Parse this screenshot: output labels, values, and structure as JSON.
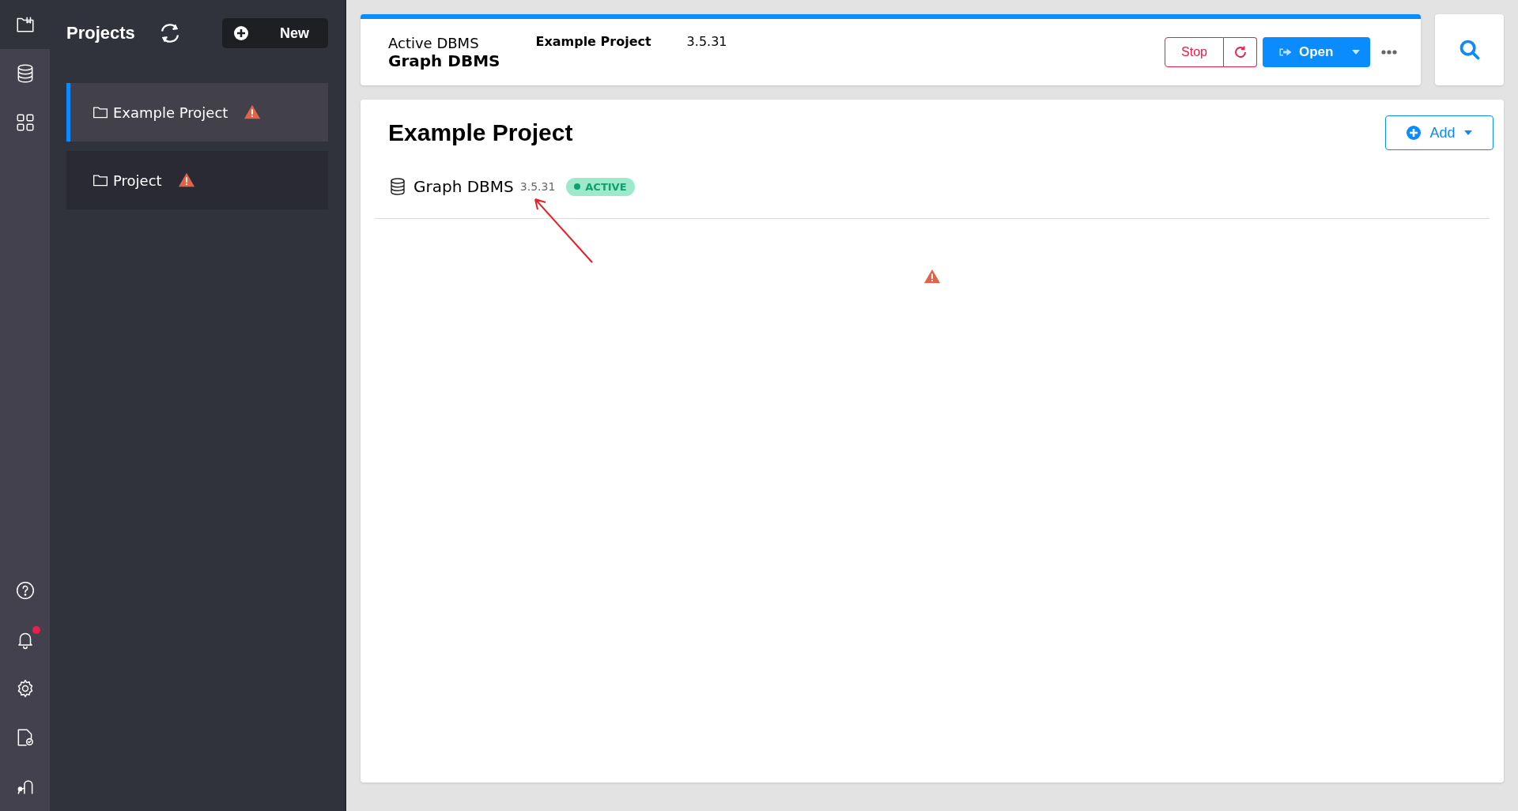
{
  "rail": {
    "top": [
      {
        "kind": "projects",
        "selected": true
      },
      {
        "kind": "database",
        "selected": false
      },
      {
        "kind": "apps",
        "selected": false
      }
    ],
    "bottom": [
      {
        "kind": "help",
        "badge": false
      },
      {
        "kind": "bell",
        "badge": true
      },
      {
        "kind": "settings",
        "badge": false
      },
      {
        "kind": "license",
        "badge": false
      },
      {
        "kind": "graph",
        "badge": false
      }
    ]
  },
  "sidebar": {
    "title": "Projects",
    "new_button": "New",
    "projects": [
      {
        "name": "Example Project",
        "warning": true,
        "selected": true
      },
      {
        "name": "Project",
        "warning": true,
        "selected": false
      }
    ]
  },
  "active_bar": {
    "label": "Active DBMS",
    "dbms": "Graph DBMS",
    "project": "Example Project",
    "version": "3.5.31",
    "stop": "Stop",
    "open": "Open"
  },
  "project": {
    "title": "Example Project",
    "add": "Add",
    "dbms": [
      {
        "name": "Graph DBMS",
        "version": "3.5.31",
        "status": "ACTIVE"
      }
    ],
    "warning": true
  }
}
